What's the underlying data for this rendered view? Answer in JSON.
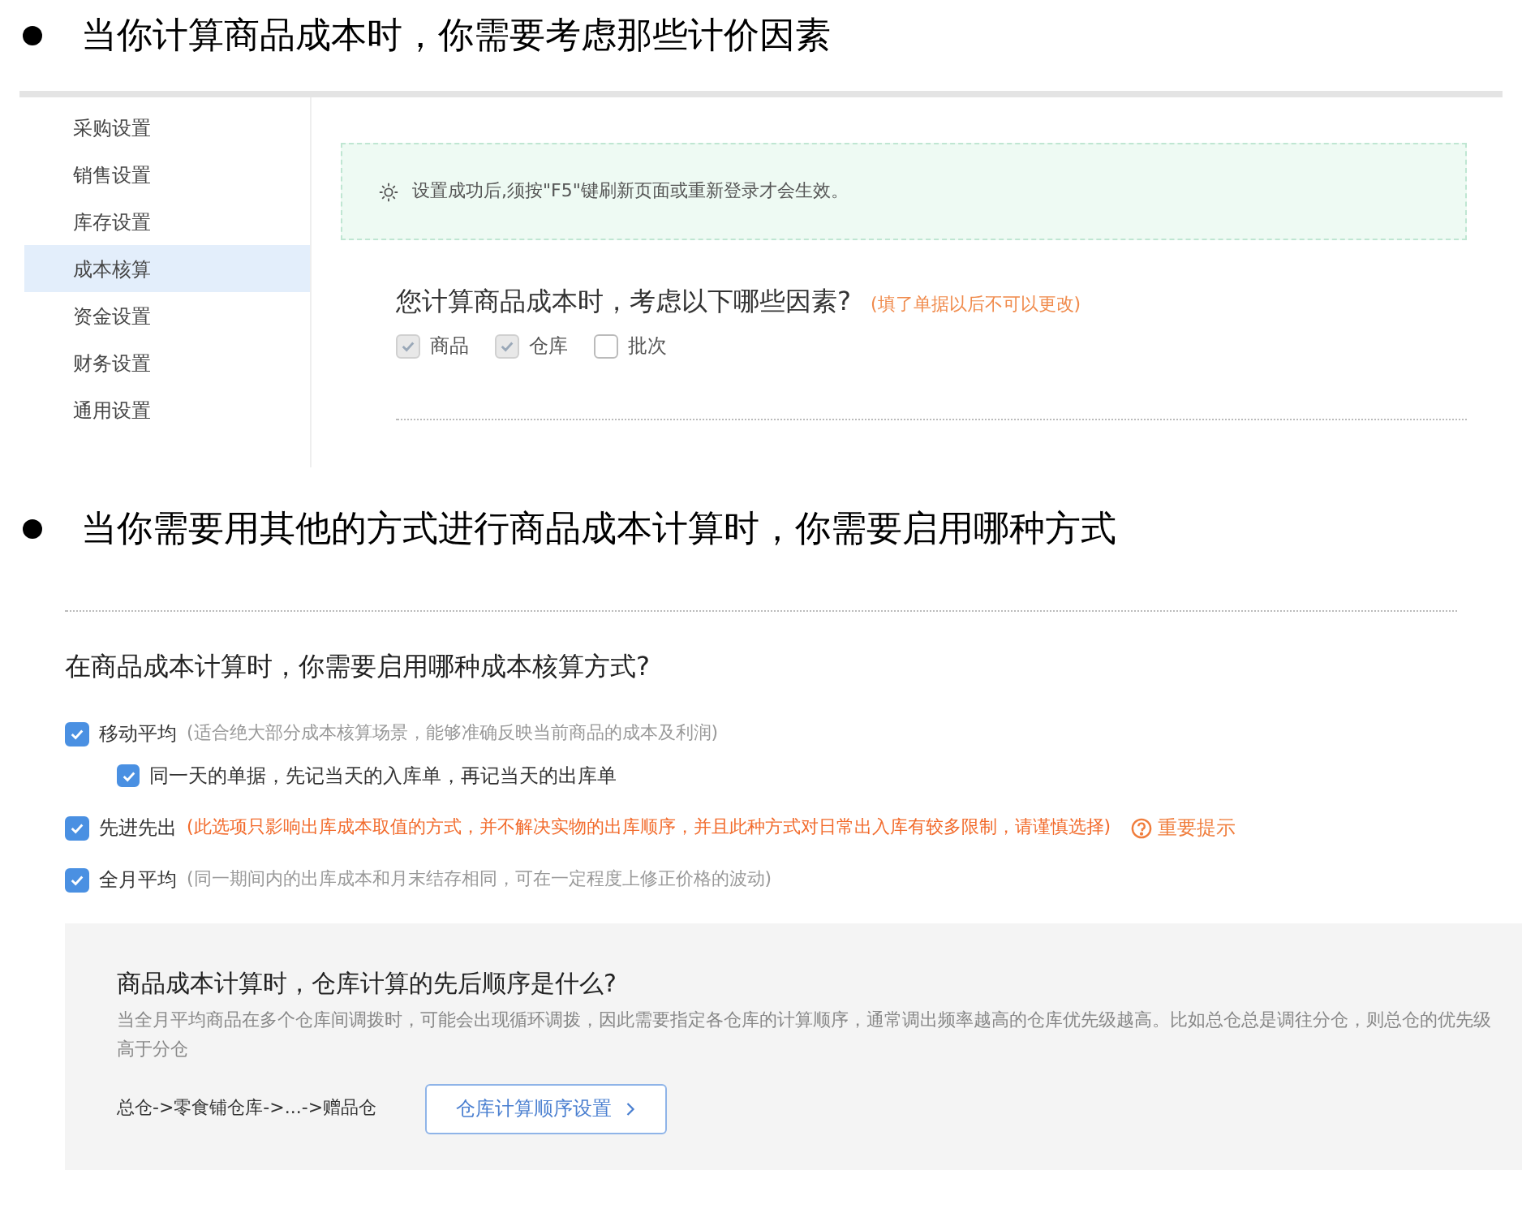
{
  "sections": [
    {
      "kind": "settings",
      "heading": "当你计算商品成本时，你需要考虑那些计价因素",
      "sidebar": {
        "items": [
          {
            "label": "采购设置",
            "selected": false
          },
          {
            "label": "销售设置",
            "selected": false
          },
          {
            "label": "库存设置",
            "selected": false
          },
          {
            "label": "成本核算",
            "selected": true
          },
          {
            "label": "资金设置",
            "selected": false
          },
          {
            "label": "财务设置",
            "selected": false
          },
          {
            "label": "通用设置",
            "selected": false
          }
        ]
      },
      "notice": "设置成功后,须按\"F5\"键刷新页面或重新登录才会生效。",
      "question": "您计算商品成本时，考虑以下哪些因素?",
      "hint": "(填了单据以后不可以更改)",
      "factors": [
        {
          "label": "商品",
          "checked": true,
          "disabled": true
        },
        {
          "label": "仓库",
          "checked": true,
          "disabled": true
        },
        {
          "label": "批次",
          "checked": false,
          "disabled": false
        }
      ]
    },
    {
      "kind": "methods",
      "heading": "当你需要用其他的方式进行商品成本计算时，你需要启用哪种方式",
      "question": "在商品成本计算时，你需要启用哪种成本核算方式?",
      "methods": [
        {
          "label": "移动平均",
          "note": "(适合绝大部分成本核算场景，能够准确反映当前商品的成本及利润)",
          "warning": false,
          "checked": true,
          "children": [
            {
              "label": "同一天的单据，先记当天的入库单，再记当天的出库单",
              "checked": true
            }
          ]
        },
        {
          "label": "先进先出",
          "note": "(此选项只影响出库成本取值的方式，并不解决实物的出库顺序，并且此种方式对日常出入库有较多限制，请谨慎选择)",
          "warning": true,
          "checked": true,
          "help": "重要提示"
        },
        {
          "label": "全月平均",
          "note": "(同一期间内的出库成本和月末结存相同，可在一定程度上修正价格的波动)",
          "warning": false,
          "checked": true
        }
      ],
      "order": {
        "title": "商品成本计算时，仓库计算的先后顺序是什么?",
        "description": "当全月平均商品在多个仓库间调拨时，可能会出现循环调拨，因此需要指定各仓库的计算顺序，通常调出频率越高的仓库优先级越高。比如总仓总是调往分仓，则总仓的优先级高于分仓",
        "sequence": "总仓->零食铺仓库->...->赠品仓",
        "button": "仓库计算顺序设置"
      }
    }
  ]
}
